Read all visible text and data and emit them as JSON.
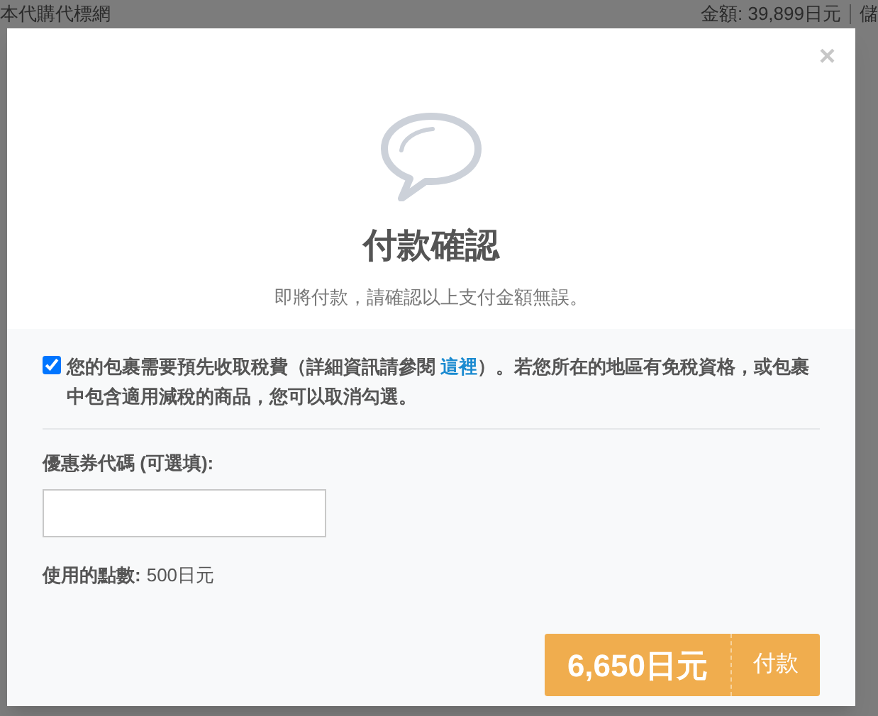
{
  "background_page": {
    "site_title": "本代購代標網",
    "balance": "金額: 39,899日元",
    "cut_text": "儲"
  },
  "dialog": {
    "close": "×",
    "title": "付款確認",
    "subtitle": "即將付款，請確認以上支付金額無誤。",
    "tax_option": {
      "checked": true,
      "text_before": "您的包裹需要預先收取稅費（詳細資訊請參閱 ",
      "link": "這裡",
      "text_after": "）。若您所在的地區有免稅資格，或包裹中包含適用減稅的商品，您可以取消勾選。"
    },
    "coupon": {
      "label": "優惠券代碼 (可選填):"
    },
    "points": {
      "label": "使用的點數:",
      "value": "500日元"
    },
    "pay_button": {
      "amount": "6,650日元",
      "label": "付款"
    }
  }
}
